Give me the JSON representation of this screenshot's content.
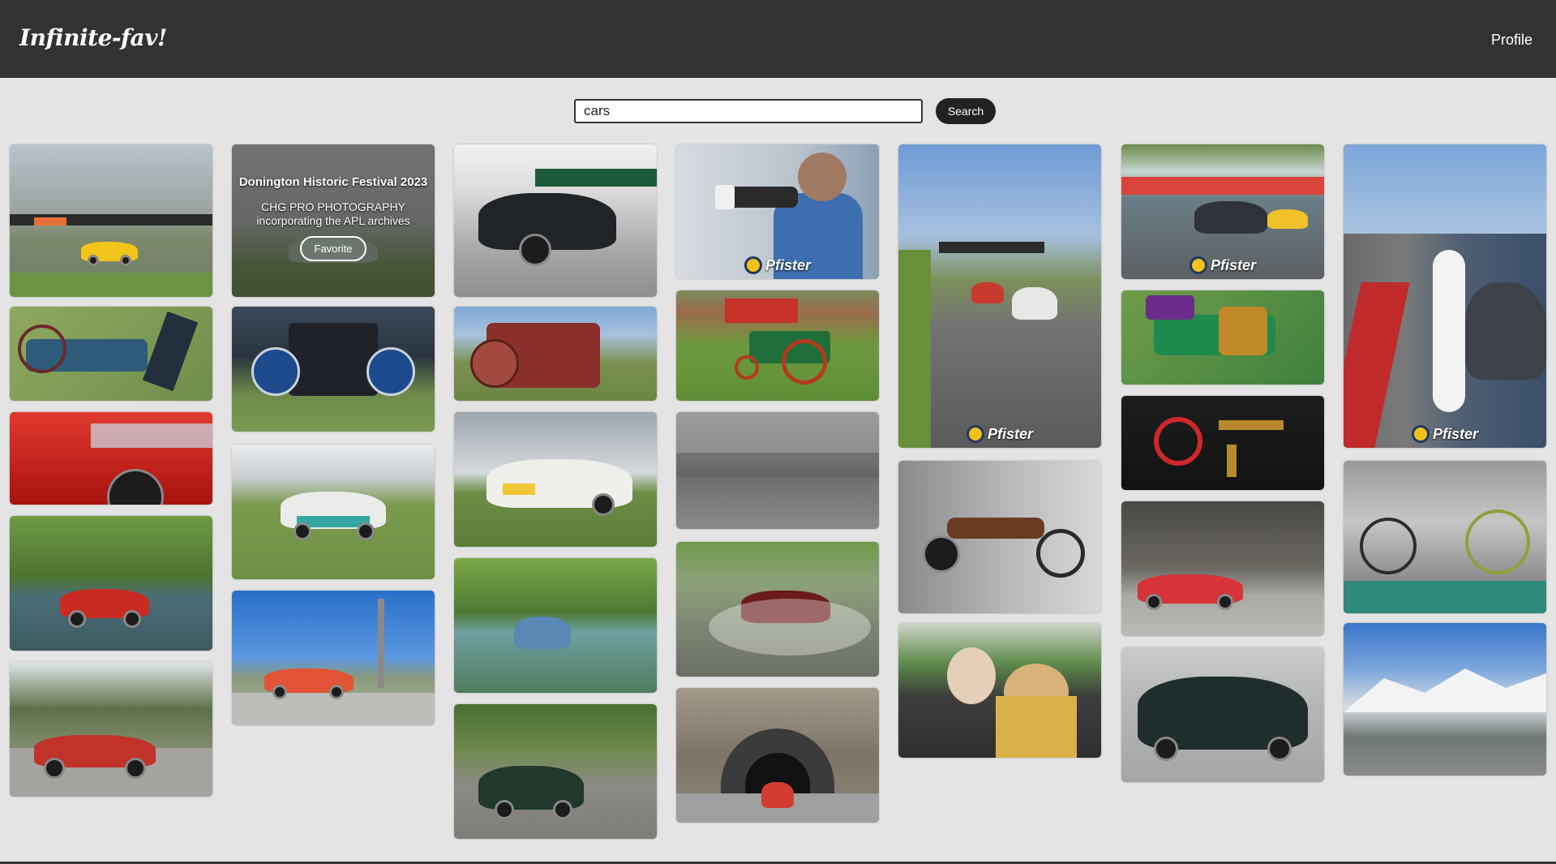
{
  "header": {
    "logo": "Infinite-fav!",
    "profile_link": "Profile"
  },
  "search": {
    "value": "cars",
    "button_label": "Search"
  },
  "hover_overlay": {
    "title": "Donington Historic Festival 2023",
    "line1": "CHG PRO PHOTOGRAPHY",
    "line2": "incorporating the APL archives",
    "favorite_label": "Favorite"
  },
  "watermark_text": "Pfister",
  "colors": {
    "header_bg": "#323232",
    "page_bg": "#e4e4e4",
    "button_bg": "#222222"
  }
}
